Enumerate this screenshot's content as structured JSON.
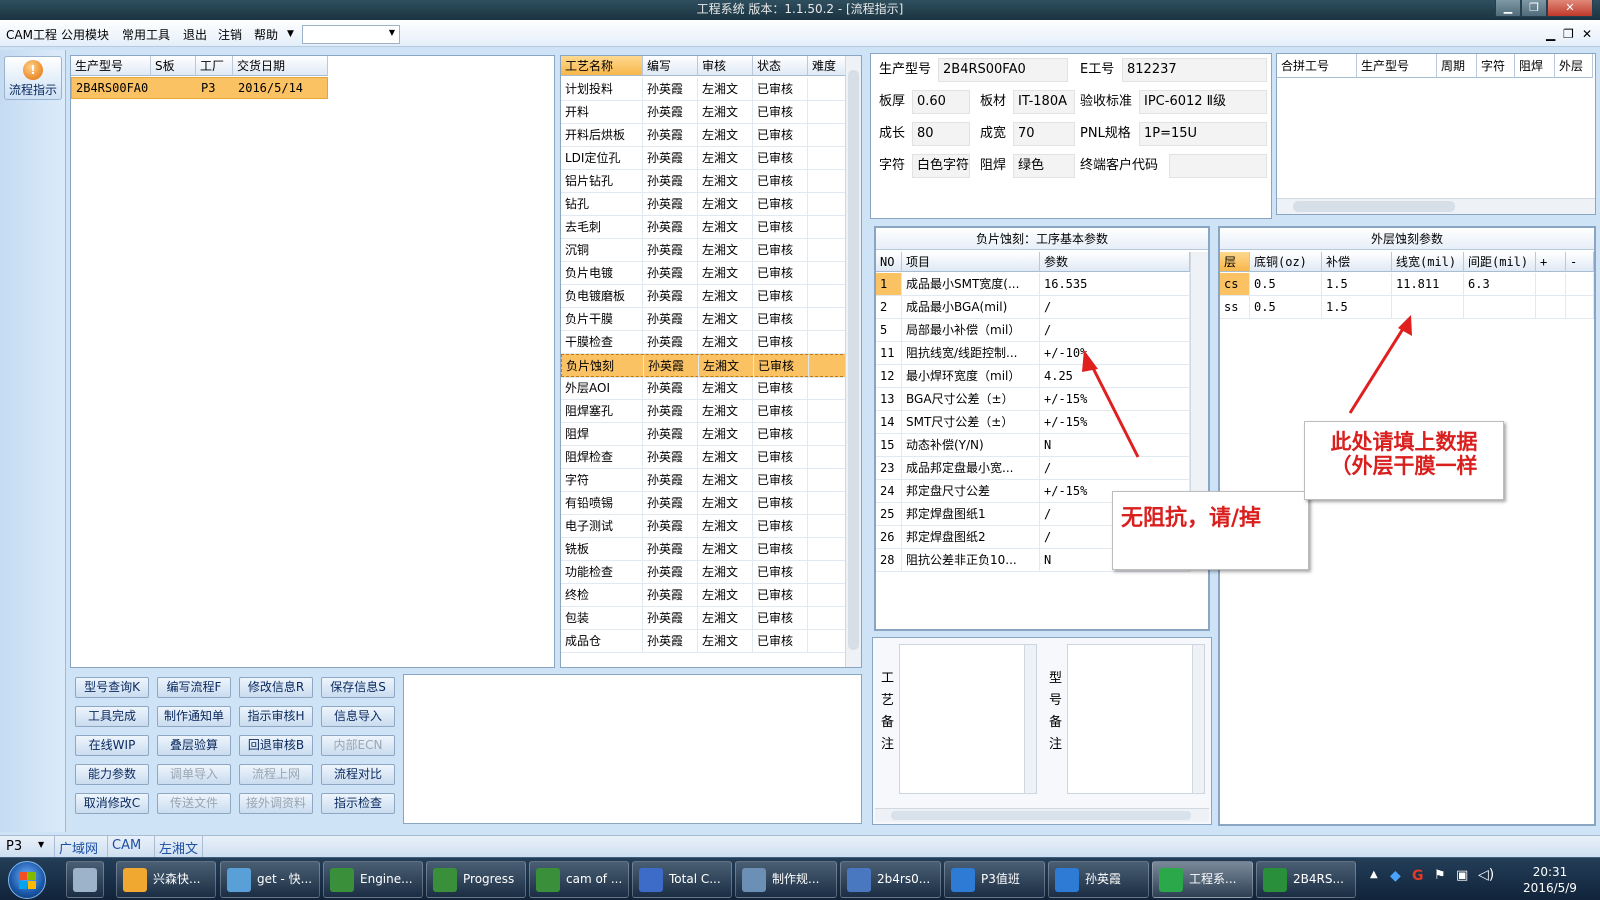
{
  "window": {
    "title": "工程系统   版本：1.1.50.2 - [流程指示]"
  },
  "menu": {
    "items": [
      "CAM工程",
      "公用模块",
      "常用工具",
      "退出",
      "注销",
      "帮助"
    ],
    "combo_value": ""
  },
  "left_nav": {
    "label": "流程指示"
  },
  "model_list": {
    "headers": [
      "生产型号",
      "S板",
      "工厂",
      "交货日期"
    ],
    "rows": [
      [
        "2B4RS00FA0",
        "",
        "P3",
        "2016/5/14"
      ]
    ]
  },
  "process": {
    "headers": [
      "工艺名称",
      "编写",
      "审核",
      "状态",
      "难度"
    ],
    "rows": [
      [
        "计划投料",
        "孙英霞",
        "左湘文",
        "已审核",
        ""
      ],
      [
        "开料",
        "孙英霞",
        "左湘文",
        "已审核",
        ""
      ],
      [
        "开料后烘板",
        "孙英霞",
        "左湘文",
        "已审核",
        ""
      ],
      [
        "LDI定位孔",
        "孙英霞",
        "左湘文",
        "已审核",
        ""
      ],
      [
        "铝片钻孔",
        "孙英霞",
        "左湘文",
        "已审核",
        ""
      ],
      [
        "钻孔",
        "孙英霞",
        "左湘文",
        "已审核",
        ""
      ],
      [
        "去毛刺",
        "孙英霞",
        "左湘文",
        "已审核",
        ""
      ],
      [
        "沉铜",
        "孙英霞",
        "左湘文",
        "已审核",
        ""
      ],
      [
        "负片电镀",
        "孙英霞",
        "左湘文",
        "已审核",
        ""
      ],
      [
        "负电镀磨板",
        "孙英霞",
        "左湘文",
        "已审核",
        ""
      ],
      [
        "负片干膜",
        "孙英霞",
        "左湘文",
        "已审核",
        ""
      ],
      [
        "干膜检查",
        "孙英霞",
        "左湘文",
        "已审核",
        ""
      ],
      [
        "负片蚀刻",
        "孙英霞",
        "左湘文",
        "已审核",
        ""
      ],
      [
        "外层AOI",
        "孙英霞",
        "左湘文",
        "已审核",
        ""
      ],
      [
        "阻焊塞孔",
        "孙英霞",
        "左湘文",
        "已审核",
        ""
      ],
      [
        "阻焊",
        "孙英霞",
        "左湘文",
        "已审核",
        ""
      ],
      [
        "阻焊检查",
        "孙英霞",
        "左湘文",
        "已审核",
        ""
      ],
      [
        "字符",
        "孙英霞",
        "左湘文",
        "已审核",
        ""
      ],
      [
        "有铅喷锡",
        "孙英霞",
        "左湘文",
        "已审核",
        ""
      ],
      [
        "电子测试",
        "孙英霞",
        "左湘文",
        "已审核",
        ""
      ],
      [
        "铣板",
        "孙英霞",
        "左湘文",
        "已审核",
        ""
      ],
      [
        "功能检查",
        "孙英霞",
        "左湘文",
        "已审核",
        ""
      ],
      [
        "终检",
        "孙英霞",
        "左湘文",
        "已审核",
        ""
      ],
      [
        "包装",
        "孙英霞",
        "左湘文",
        "已审核",
        ""
      ],
      [
        "成品仓",
        "孙英霞",
        "左湘文",
        "已审核",
        ""
      ]
    ],
    "selected_index": 12
  },
  "buttons": [
    [
      {
        "label": "型号查询K",
        "enabled": true
      },
      {
        "label": "编写流程F",
        "enabled": true
      },
      {
        "label": "修改信息R",
        "enabled": true
      },
      {
        "label": "保存信息S",
        "enabled": true
      }
    ],
    [
      {
        "label": "工具完成",
        "enabled": true
      },
      {
        "label": "制作通知单",
        "enabled": true
      },
      {
        "label": "指示审核H",
        "enabled": true
      },
      {
        "label": "信息导入",
        "enabled": true
      }
    ],
    [
      {
        "label": "在线WIP",
        "enabled": true
      },
      {
        "label": "叠层验算",
        "enabled": true
      },
      {
        "label": "回退审核B",
        "enabled": true
      },
      {
        "label": "内部ECN",
        "enabled": false
      }
    ],
    [
      {
        "label": "能力参数",
        "enabled": true
      },
      {
        "label": "调单导入",
        "enabled": false
      },
      {
        "label": "流程上网",
        "enabled": false
      },
      {
        "label": "流程对比",
        "enabled": true
      }
    ],
    [
      {
        "label": "取消修改C",
        "enabled": true
      },
      {
        "label": "传送文件",
        "enabled": false
      },
      {
        "label": "接外调资料",
        "enabled": false
      },
      {
        "label": "指示检查",
        "enabled": true
      }
    ]
  ],
  "info": {
    "model_label": "生产型号",
    "model": "2B4RS00FA0",
    "eno_label": "E工号",
    "eno": "812237",
    "thick_label": "板厚",
    "thick": "0.60",
    "mat_label": "板材",
    "mat": "IT-180A",
    "std_label": "验收标准",
    "std": "IPC-6012 Ⅱ级",
    "len_label": "成长",
    "len": "80",
    "wid_label": "成宽",
    "wid": "70",
    "pnl_label": "PNL规格",
    "pnl": "1P=15U",
    "char_label": "字符",
    "char": "白色字符",
    "mask_label": "阻焊",
    "mask": "绿色",
    "cust_label": "终端客户代码",
    "cust": ""
  },
  "combine": {
    "headers": [
      "合拼工号",
      "生产型号",
      "周期",
      "字符",
      "阻焊",
      "外层"
    ]
  },
  "params": {
    "title": "负片蚀刻：工序基本参数",
    "headers": [
      "NO",
      "项目",
      "参数"
    ],
    "rows": [
      [
        "1",
        "成品最小SMT宽度(...",
        "16.535"
      ],
      [
        "2",
        "成品最小BGA(mil)",
        "/"
      ],
      [
        "5",
        "局部最小补偿（mil）",
        "/"
      ],
      [
        "11",
        "阻抗线宽/线距控制...",
        "+/-10%"
      ],
      [
        "12",
        "最小焊环宽度（mil）",
        "4.25"
      ],
      [
        "13",
        "BGA尺寸公差（±）",
        "+/-15%"
      ],
      [
        "14",
        "SMT尺寸公差（±）",
        "+/-15%"
      ],
      [
        "15",
        "动态补偿(Y/N)",
        "N"
      ],
      [
        "23",
        "成品邦定盘最小宽...",
        "/"
      ],
      [
        "24",
        "邦定盘尺寸公差",
        "+/-15%"
      ],
      [
        "25",
        "邦定焊盘图纸1",
        "/"
      ],
      [
        "26",
        "邦定焊盘图纸2",
        "/"
      ],
      [
        "28",
        "阻抗公差非正负10...",
        "N"
      ]
    ],
    "selected_index": 0
  },
  "etch": {
    "title": "外层蚀刻参数",
    "headers": [
      "层",
      "底铜(oz)",
      "补偿",
      "线宽(mil)",
      "间距(mil)",
      "+",
      "-"
    ],
    "rows": [
      [
        "cs",
        "0.5",
        "1.5",
        "11.811",
        "6.3",
        "",
        ""
      ],
      [
        "ss",
        "0.5",
        "1.5",
        "",
        "",
        "",
        ""
      ]
    ],
    "selected_index": 0
  },
  "notes": {
    "process_label": "工艺备注",
    "model_label": "型号备注"
  },
  "annotations": {
    "callout1": "无阻抗，请/掉",
    "callout2_line1": "此处请填上数据",
    "callout2_line2": "（外层干膜一样",
    "arrow_color": "#e01f1f"
  },
  "statusbar": {
    "factory": "P3",
    "items": [
      "广域网",
      "CAM",
      "左湘文"
    ]
  },
  "taskbar": {
    "items": [
      "兴森快...",
      "get - 快...",
      "Engine...",
      "Progress",
      "cam of ...",
      "Total C...",
      "制作规...",
      "2b4rs0...",
      "P3值班",
      "孙英霞",
      "工程系...",
      "2B4RS..."
    ],
    "time": "20:31",
    "date": "2016/5/9"
  }
}
